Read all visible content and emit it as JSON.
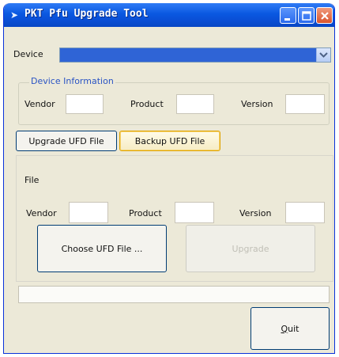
{
  "window": {
    "title": "PKT Pfu Upgrade Tool",
    "buttons": {
      "minimize_icon": "minimize-icon",
      "maximize_icon": "maximize-icon",
      "close_icon": "close-icon"
    }
  },
  "device": {
    "label": "Device",
    "selected": "",
    "dropdown_icon": "chevron-down-icon"
  },
  "device_info": {
    "title": "Device Information",
    "vendor_label": "Vendor",
    "vendor_value": "",
    "product_label": "Product",
    "product_value": "",
    "version_label": "Version",
    "version_value": ""
  },
  "tabs": [
    {
      "label": "Upgrade UFD File"
    },
    {
      "label": "Backup UFD File"
    }
  ],
  "file_panel": {
    "file_label": "File",
    "vendor_label": "Vendor",
    "vendor_value": "",
    "product_label": "Product",
    "product_value": "",
    "version_label": "Version",
    "version_value": "",
    "choose_label": "Choose UFD File ...",
    "upgrade_label": "Upgrade"
  },
  "progress": {
    "value": 0
  },
  "quit": {
    "label_first": "Q",
    "label_rest": "uit"
  },
  "colors": {
    "titlebar": "#0a58e1",
    "device_combo": "#2f64d6",
    "group_title": "#2a54c4",
    "window_bg": "#ece9d8"
  }
}
